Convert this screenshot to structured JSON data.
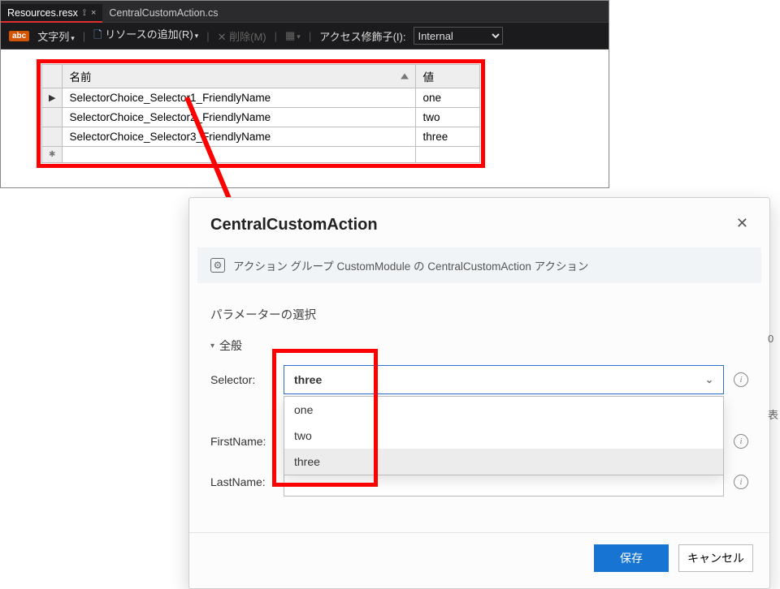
{
  "vs": {
    "tabs": {
      "active": "Resources.resx",
      "inactive": "CentralCustomAction.cs"
    },
    "toolbar": {
      "strings_label": "文字列",
      "add_resource_label": "リソースの追加(R)",
      "remove_label": "削除(M)",
      "access_label": "アクセス修飾子(I):",
      "access_value": "Internal"
    },
    "table": {
      "header_name": "名前",
      "header_value": "値",
      "rows": [
        {
          "name": "SelectorChoice_Selector1_FriendlyName",
          "value": "one"
        },
        {
          "name": "SelectorChoice_Selector2_FriendlyName",
          "value": "two"
        },
        {
          "name": "SelectorChoice_Selector3_FriendlyName",
          "value": "three"
        }
      ]
    }
  },
  "pad": {
    "title": "CentralCustomAction",
    "banner_text": "アクション グループ CustomModule の CentralCustomAction アクション",
    "section_label": "パラメーターの選択",
    "group_label": "全般",
    "fields": {
      "selector": {
        "label": "Selector:",
        "value": "three",
        "options": [
          "one",
          "two",
          "three"
        ]
      },
      "first_name": {
        "label": "FirstName:"
      },
      "last_name": {
        "label": "LastName:"
      }
    },
    "buttons": {
      "save": "保存",
      "cancel": "キャンセル"
    }
  },
  "page_side": {
    "line1": "0",
    "line2": "表"
  }
}
